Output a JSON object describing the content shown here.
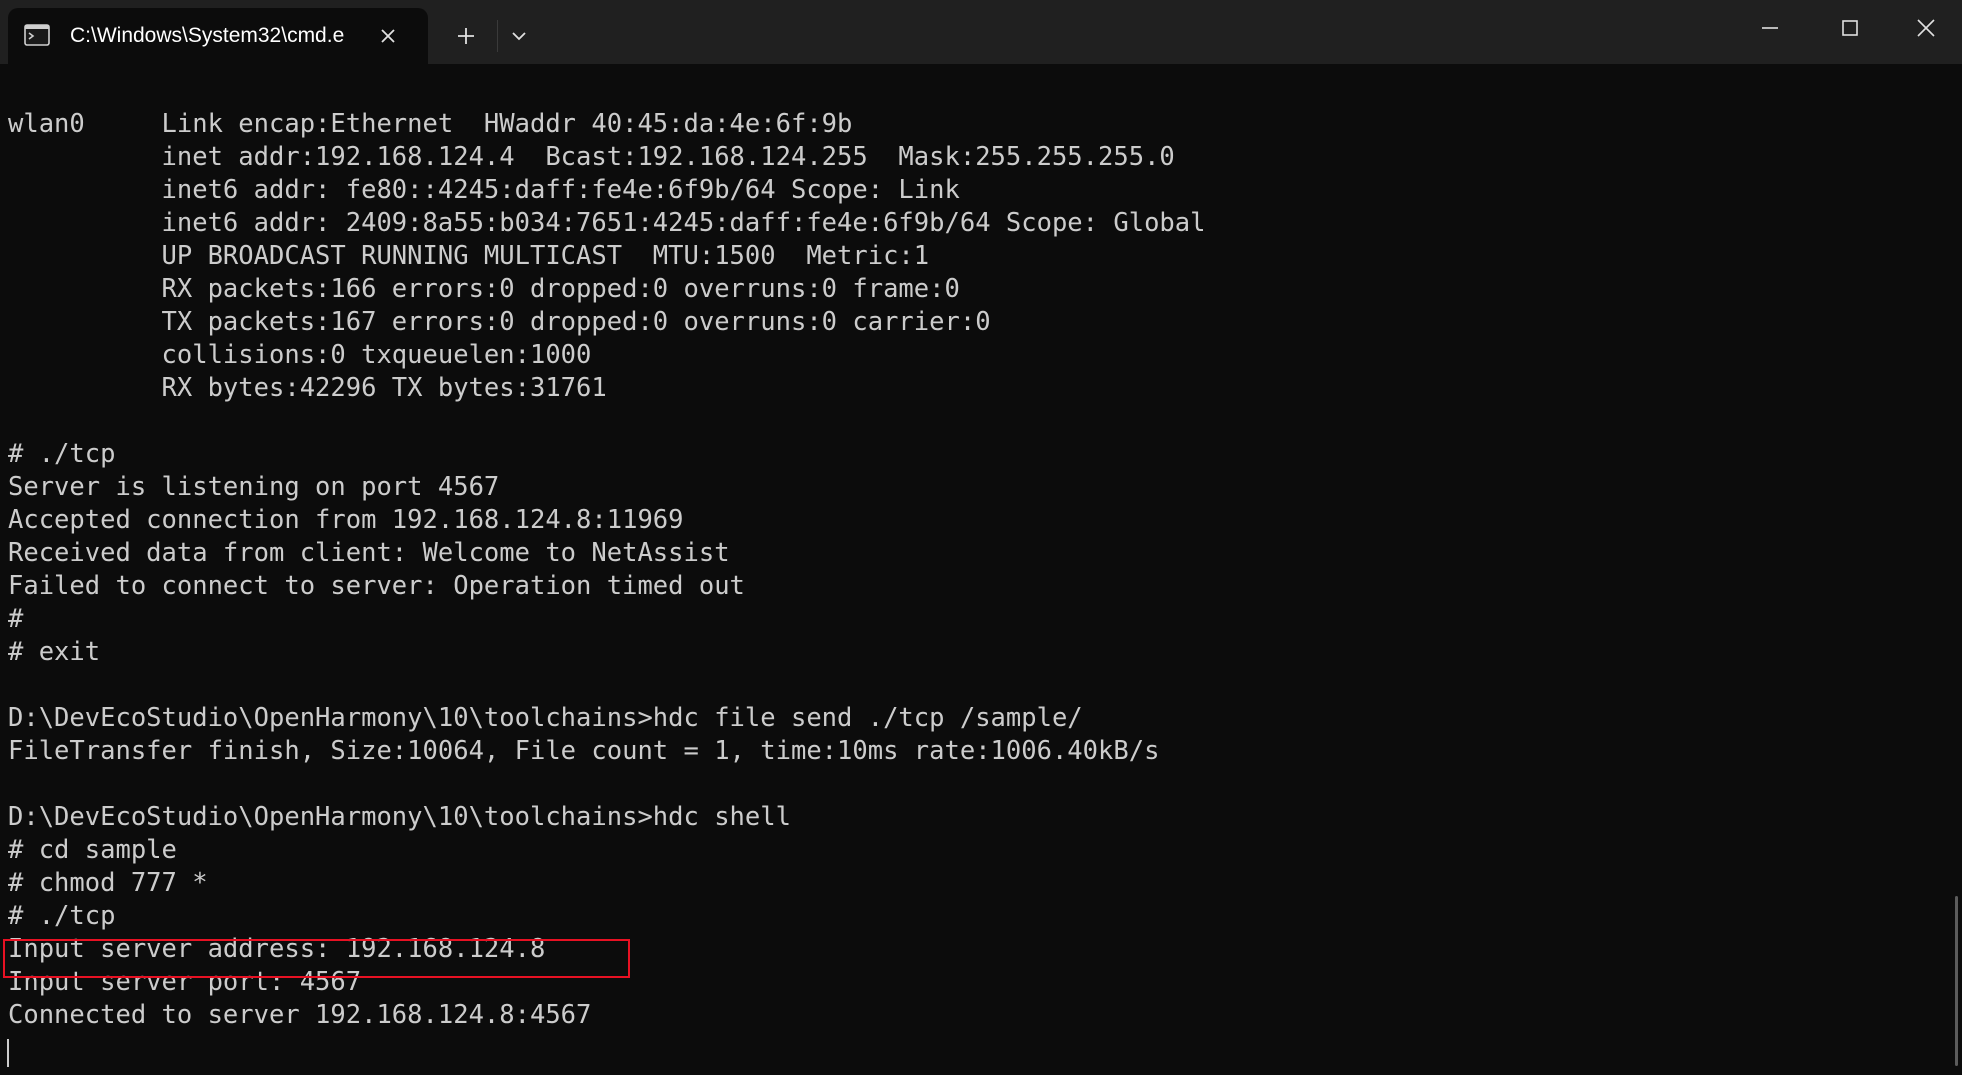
{
  "titlebar": {
    "tab_title": "C:\\Windows\\System32\\cmd.e",
    "tab_icon": "terminal-icon",
    "close_tab_icon": "close-icon",
    "new_tab_icon": "plus-icon",
    "dropdown_icon": "chevron-down-icon",
    "window_controls": [
      "minimize-icon",
      "maximize-icon",
      "close-icon"
    ]
  },
  "terminal": {
    "background": "#0c0c0c",
    "foreground": "#cccccc",
    "highlight_color": "#e81123",
    "lines": [
      "wlan0     Link encap:Ethernet  HWaddr 40:45:da:4e:6f:9b",
      "          inet addr:192.168.124.4  Bcast:192.168.124.255  Mask:255.255.255.0",
      "          inet6 addr: fe80::4245:daff:fe4e:6f9b/64 Scope: Link",
      "          inet6 addr: 2409:8a55:b034:7651:4245:daff:fe4e:6f9b/64 Scope: Global",
      "          UP BROADCAST RUNNING MULTICAST  MTU:1500  Metric:1",
      "          RX packets:166 errors:0 dropped:0 overruns:0 frame:0",
      "          TX packets:167 errors:0 dropped:0 overruns:0 carrier:0",
      "          collisions:0 txqueuelen:1000",
      "          RX bytes:42296 TX bytes:31761",
      "",
      "# ./tcp",
      "Server is listening on port 4567",
      "Accepted connection from 192.168.124.8:11969",
      "Received data from client: Welcome to NetAssist",
      "Failed to connect to server: Operation timed out",
      "#",
      "# exit",
      "",
      "D:\\DevEcoStudio\\OpenHarmony\\10\\toolchains>hdc file send ./tcp /sample/",
      "FileTransfer finish, Size:10064, File count = 1, time:10ms rate:1006.40kB/s",
      "",
      "D:\\DevEcoStudio\\OpenHarmony\\10\\toolchains>hdc shell",
      "# cd sample",
      "# chmod 777 *",
      "# ./tcp",
      "Input server address: 192.168.124.8",
      "Input server port: 4567",
      "Connected to server 192.168.124.8:4567"
    ]
  }
}
